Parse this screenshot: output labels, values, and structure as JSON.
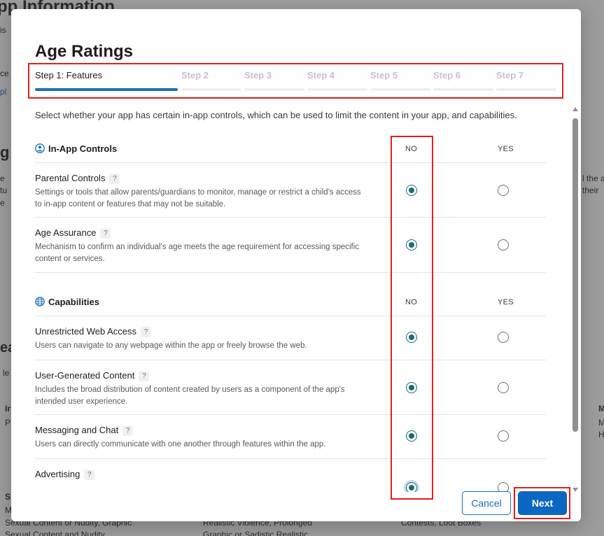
{
  "background": {
    "page_title_fragment": "pp Information",
    "frag_1": "is",
    "frag_2": "ce",
    "frag_3": "pl",
    "frag_4": "g",
    "frag_5": "e",
    "frag_6": "tu",
    "frag_7": "e",
    "frag_8": "ea",
    "frag_9": "le",
    "frag_10": "Ir",
    "frag_11": "P",
    "right_frag_1": "l the a",
    "right_frag_2": "their",
    "right_frag_3": "M",
    "right_frag_4": "M",
    "right_frag_5": "H",
    "bottom_left_1": "S",
    "bottom_left_2": "M",
    "bottom_left_3": "Sexual Content or Nudity, Graphic",
    "bottom_left_4": "Sexual Content and Nudity",
    "bottom_mid_1": "Realistic Violence, Prolonged",
    "bottom_mid_2": "Graphic or Sadistic Realistic",
    "bottom_right_1": "Contests, Loot Boxes"
  },
  "modal": {
    "title": "Age Ratings",
    "steps": [
      {
        "label": "Step 1: Features",
        "active": true
      },
      {
        "label": "Step 2",
        "active": false
      },
      {
        "label": "Step 3",
        "active": false
      },
      {
        "label": "Step 4",
        "active": false
      },
      {
        "label": "Step 5",
        "active": false
      },
      {
        "label": "Step 6",
        "active": false
      },
      {
        "label": "Step 7",
        "active": false
      }
    ],
    "intro": "Select whether your app has certain in-app controls, which can be used to limit the content in your app, and capabilities.",
    "col_no": "NO",
    "col_yes": "YES",
    "help_glyph": "?",
    "sections": [
      {
        "title": "In-App Controls",
        "icon": "person-circle-icon",
        "rows": [
          {
            "title": "Parental Controls",
            "desc": "Settings or tools that allow parents/guardians to monitor, manage or restrict a child's access to in-app content or features that may not be suitable.",
            "value": "NO"
          },
          {
            "title": "Age Assurance",
            "desc": "Mechanism to confirm an individual's age meets the age requirement for accessing specific content or services.",
            "value": "NO"
          }
        ]
      },
      {
        "title": "Capabilities",
        "icon": "globe-icon",
        "rows": [
          {
            "title": "Unrestricted Web Access",
            "desc": "Users can navigate to any webpage within the app or freely browse the web.",
            "value": "NO"
          },
          {
            "title": "User-Generated Content",
            "desc": "Includes the broad distribution of content created by users as a component of the app's intended user experience.",
            "value": "NO"
          },
          {
            "title": "Messaging and Chat",
            "desc": "Users can directly communicate with one another through features within the app.",
            "value": "NO"
          },
          {
            "title": "Advertising",
            "desc": "",
            "value": "NO"
          }
        ]
      }
    ],
    "cancel_label": "Cancel",
    "next_label": "Next"
  },
  "colors": {
    "accent": "#0b67c2",
    "radio_checked": "#1a6b7a",
    "annotation": "#e01f1f"
  }
}
